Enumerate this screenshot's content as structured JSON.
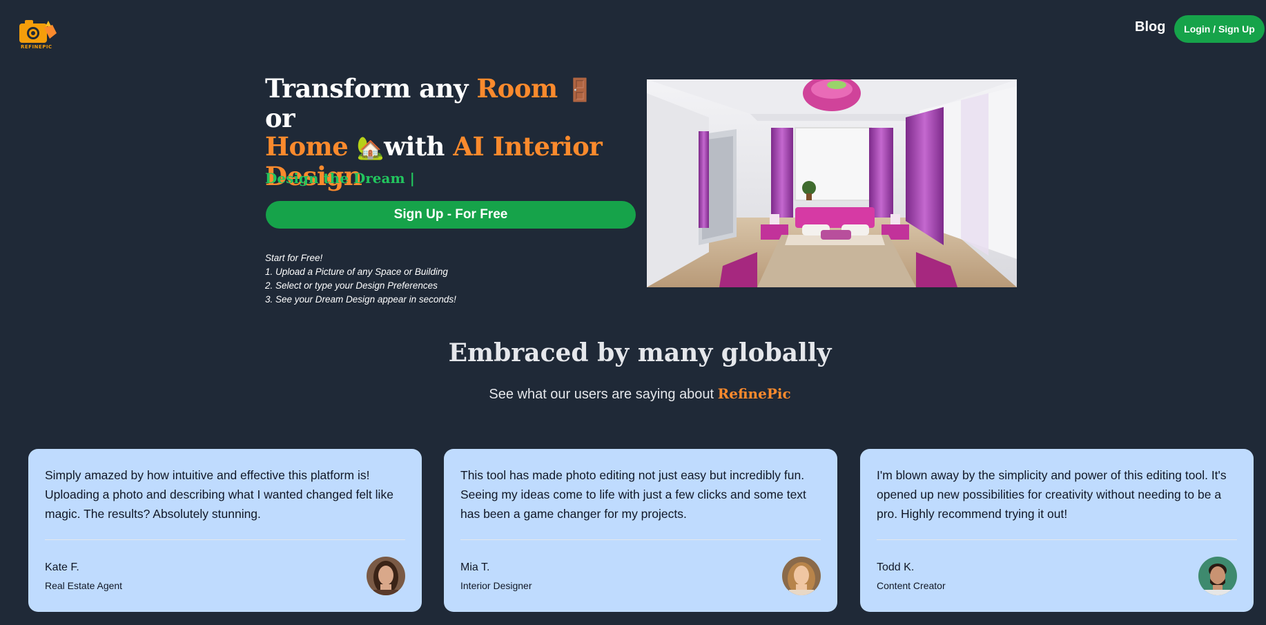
{
  "header": {
    "logo_text": "REFINEPIC",
    "nav_blog": "Blog",
    "login_label": "Login / Sign Up"
  },
  "hero": {
    "title_part1": "Transform any ",
    "title_room": "Room",
    "title_emoji_door": "🚪",
    "title_or": " or",
    "title_home": "Home",
    "title_emoji_house": "🏡",
    "title_with": "with ",
    "title_ai": "AI Interior Design",
    "tagline": "Design the Dream |",
    "signup_label": "Sign Up - For Free",
    "steps": [
      "Start for Free!",
      "1. Upload a Picture of any Space or Building",
      "2. Select or type your Design Preferences",
      "3. See your Dream Design appear in seconds!"
    ]
  },
  "testimonials_section": {
    "title": "Embraced by many globally",
    "subtitle": "See what our users are saying about ",
    "brand": "RefinePic"
  },
  "testimonials": [
    {
      "quote": "Simply amazed by how intuitive and effective this platform is! Uploading a photo and describing what I wanted changed felt like magic. The results? Absolutely stunning.",
      "name": "Kate F.",
      "role": "Real Estate Agent"
    },
    {
      "quote": "This tool has made photo editing not just easy but incredibly fun. Seeing my ideas come to life with just a few clicks and some text has been a game changer for my projects.",
      "name": "Mia T.",
      "role": "Interior Designer"
    },
    {
      "quote": "I'm blown away by the simplicity and power of this editing tool. It's opened up new possibilities for creativity without needing to be a pro. Highly recommend trying it out!",
      "name": "Todd K.",
      "role": "Content Creator"
    }
  ],
  "colors": {
    "background": "#1f2937",
    "accent_orange": "#fb8a2d",
    "green_button": "#16a34a",
    "green_text": "#22c55e",
    "card_bg": "#bfdbfe"
  },
  "icons": [
    "camera-logo-icon"
  ]
}
